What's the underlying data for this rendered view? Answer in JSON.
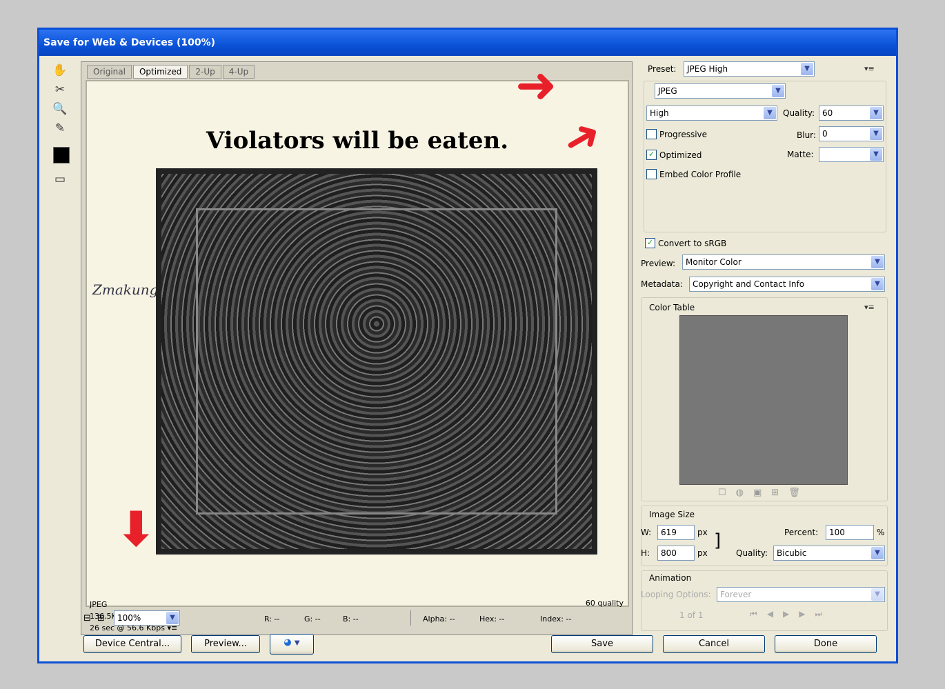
{
  "window": {
    "title": "Save for Web & Devices (100%)"
  },
  "tabs": [
    "Original",
    "Optimized",
    "2-Up",
    "4-Up"
  ],
  "image": {
    "sign_text": "Violators will be eaten.",
    "handwriting": "Zmakung",
    "info_format": "JPEG",
    "info_size": "136.5K",
    "info_time": "26 sec @ 56.6 Kbps",
    "info_quality": "60 quality"
  },
  "settings": {
    "preset_label": "Preset:",
    "preset": "JPEG High",
    "format": "JPEG",
    "compression": "High",
    "quality_label": "Quality:",
    "quality": "60",
    "blur_label": "Blur:",
    "blur": "0",
    "matte_label": "Matte:",
    "matte": "",
    "progressive_label": "Progressive",
    "progressive": false,
    "optimized_label": "Optimized",
    "optimized": true,
    "embed_label": "Embed Color Profile",
    "embed": false,
    "convert_label": "Convert to sRGB",
    "convert": true,
    "preview_label": "Preview:",
    "preview": "Monitor Color",
    "metadata_label": "Metadata:",
    "metadata": "Copyright and Contact Info"
  },
  "color_table": {
    "title": "Color Table"
  },
  "image_size": {
    "title": "Image Size",
    "w_label": "W:",
    "w": "619",
    "h_label": "H:",
    "h": "800",
    "unit": "px",
    "percent_label": "Percent:",
    "percent": "100",
    "percent_unit": "%",
    "quality_label": "Quality:",
    "quality": "Bicubic"
  },
  "animation": {
    "title": "Animation",
    "looping_label": "Looping Options:",
    "looping": "Forever",
    "frame": "1 of 1"
  },
  "statusbar": {
    "zoom": "100%",
    "r": "R: --",
    "g": "G: --",
    "b": "B: --",
    "alpha": "Alpha: --",
    "hex": "Hex: --",
    "index": "Index: --"
  },
  "buttons": {
    "device_central": "Device Central...",
    "preview": "Preview...",
    "save": "Save",
    "cancel": "Cancel",
    "done": "Done"
  },
  "colors": {
    "titlebar": "#0a52d8",
    "annotation_arrow": "#e8202a"
  }
}
